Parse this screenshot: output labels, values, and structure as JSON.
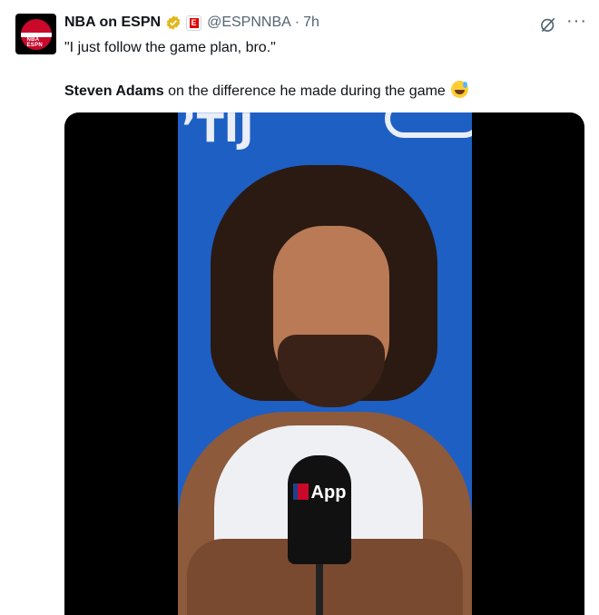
{
  "tweet": {
    "author_name": "NBA on ESPN",
    "handle": "@ESPNNBA",
    "separator": "·",
    "time": "7h",
    "affiliate_badge": "E",
    "avatar_text": "NBA ESPN",
    "quote": "\"I just follow the game plan, bro.\"",
    "caption_bold": "Steven Adams",
    "caption_rest": " on the difference he made during the game",
    "more_label": "···"
  },
  "media": {
    "mic_label": "App"
  },
  "colors": {
    "verified_badge": "#e2b719",
    "brand_red": "#c9082a",
    "text_secondary": "#536471"
  },
  "icons": [
    "verified-icon",
    "grok-icon",
    "more-icon",
    "grinning-sweat-emoji"
  ]
}
